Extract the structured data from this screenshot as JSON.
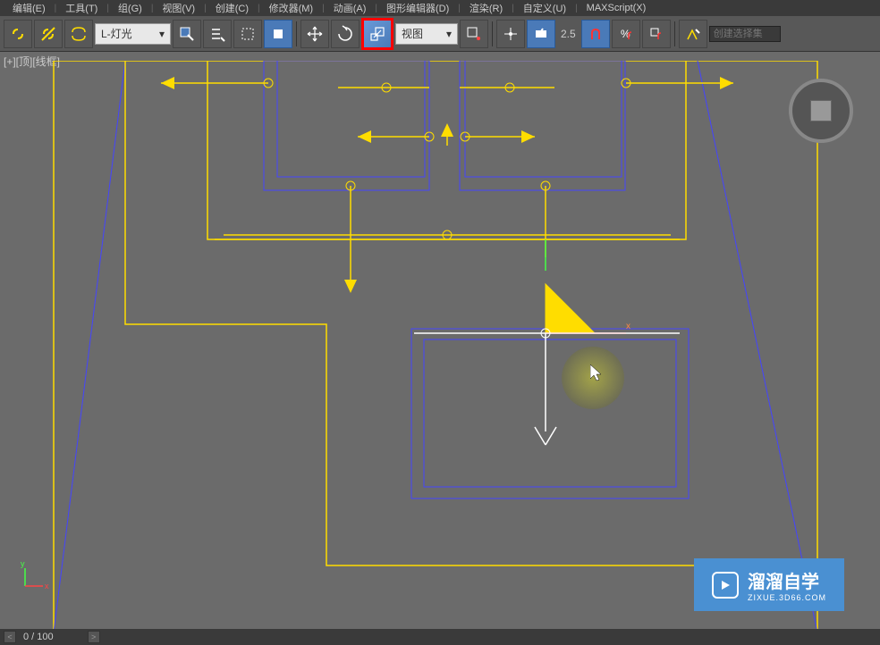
{
  "menu": {
    "edit": "编辑(E)",
    "tools": "工具(T)",
    "group": "组(G)",
    "view": "视图(V)",
    "create": "创建(C)",
    "modifiers": "修改器(M)",
    "animation": "动画(A)",
    "graph_editors": "图形编辑器(D)",
    "rendering": "渲染(R)",
    "customize": "自定义(U)",
    "maxscript": "MAXScript(X)"
  },
  "toolbar": {
    "filter_label": "L-灯光",
    "view_label": "视图",
    "spinner_value": "2.5",
    "selection_set": "创建选择集"
  },
  "viewport": {
    "label": "[+][顶][线框]",
    "axis_label": "x"
  },
  "status": {
    "frame": "0 / 100"
  },
  "watermark": {
    "text": "溜溜自学",
    "url": "ZIXUE.3D66.COM"
  },
  "colors": {
    "yellow": "#ffdd00",
    "blue": "#4444ff",
    "highlight_red": "#ff0000",
    "brand_blue": "#4a90d2"
  }
}
